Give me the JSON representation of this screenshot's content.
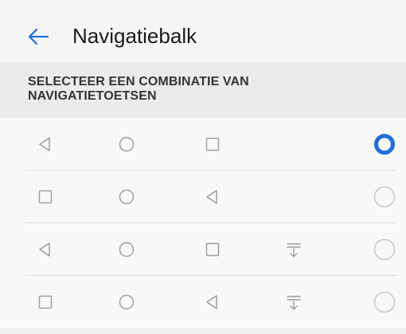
{
  "header": {
    "title": "Navigatiebalk",
    "back_icon": "arrow-left-icon"
  },
  "section": {
    "label": "SELECTEER EEN COMBINATIE VAN NAVIGATIETOETSEN"
  },
  "options": [
    {
      "keys": [
        "back-triangle-icon",
        "home-circle-icon",
        "recents-square-icon"
      ],
      "selected": true
    },
    {
      "keys": [
        "recents-square-icon",
        "home-circle-icon",
        "back-triangle-icon"
      ],
      "selected": false
    },
    {
      "keys": [
        "back-triangle-icon",
        "home-circle-icon",
        "recents-square-icon",
        "notification-pull-icon"
      ],
      "selected": false
    },
    {
      "keys": [
        "recents-square-icon",
        "home-circle-icon",
        "back-triangle-icon",
        "notification-pull-icon"
      ],
      "selected": false
    }
  ],
  "colors": {
    "accent": "#1e6fd9",
    "icon": "#9e9e9e",
    "radio_off": "#c8c8c8"
  }
}
